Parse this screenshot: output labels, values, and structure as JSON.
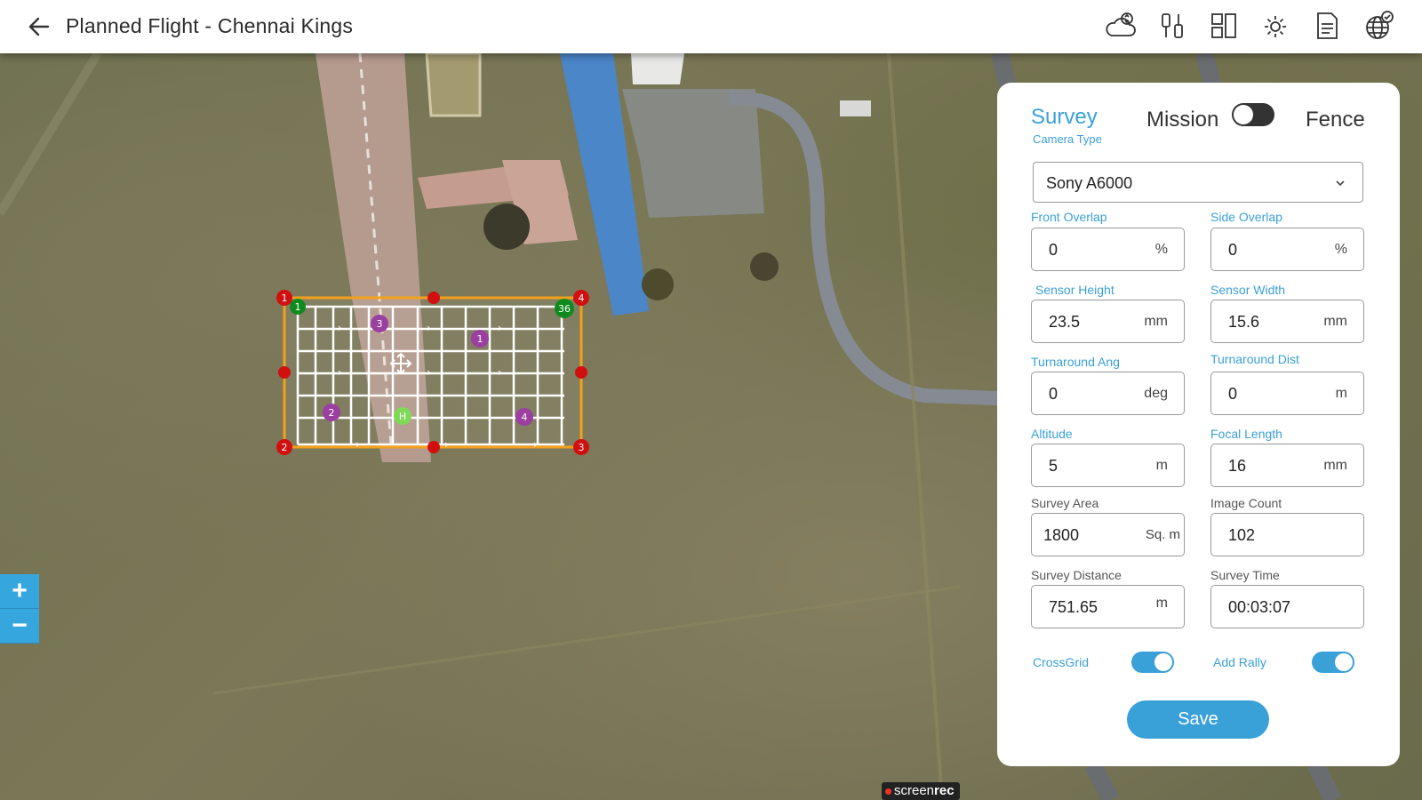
{
  "header": {
    "title": "Planned Flight - Chennai Kings",
    "tools": [
      "weather-sync-icon",
      "drone-sync-icon",
      "layout-icon",
      "settings-icon",
      "document-icon",
      "globe-check-icon"
    ]
  },
  "map": {
    "zoom_in_label": "+",
    "zoom_out_label": "−",
    "vertices": {
      "v1": "1",
      "v2": "2",
      "v3": "3",
      "v4": "4"
    },
    "waypoint_start": "1",
    "waypoint_end": "36",
    "rally_points": {
      "r1": "1",
      "r2": "2",
      "r3": "3",
      "r4": "4"
    },
    "home_label": "H"
  },
  "watermark": {
    "part1": "screen",
    "part2": "rec"
  },
  "panel": {
    "tabs": {
      "survey": "Survey",
      "mission": "Mission",
      "fence": "Fence"
    },
    "camera_type_label": "Camera Type",
    "camera_type_value": "Sony A6000",
    "fields": {
      "front_overlap": {
        "label": "Front Overlap",
        "value": "0",
        "unit": "%"
      },
      "side_overlap": {
        "label": "Side Overlap",
        "value": "0",
        "unit": "%"
      },
      "sensor_height": {
        "label": "Sensor Height",
        "value": "23.5",
        "unit": "mm"
      },
      "sensor_width": {
        "label": "Sensor Width",
        "value": "15.6",
        "unit": "mm"
      },
      "turnaround_ang": {
        "label": "Turnaround Ang",
        "value": "0",
        "unit": "deg"
      },
      "turnaround_dist": {
        "label": "Turnaround Dist",
        "value": "0",
        "unit": "m"
      },
      "altitude": {
        "label": "Altitude",
        "value": "5",
        "unit": "m"
      },
      "focal_length": {
        "label": "Focal Length",
        "value": "16",
        "unit": "mm"
      },
      "survey_area": {
        "label": "Survey Area",
        "value": "1800",
        "unit": "Sq. m"
      },
      "image_count": {
        "label": "Image Count",
        "value": "102"
      },
      "survey_distance": {
        "label": "Survey Distance",
        "value": "751.65",
        "unit": "m"
      },
      "survey_time": {
        "label": "Survey Time",
        "value": "00:03:07"
      }
    },
    "crossgrid_label": "CrossGrid",
    "crossgrid_on": true,
    "add_rally_label": "Add Rally",
    "add_rally_on": true,
    "save_label": "Save"
  },
  "colors": {
    "accent": "#3aa0d8",
    "vertex": "#d10f0f",
    "waypoint": "#0f8a1f",
    "rally": "#9b3fa0",
    "home": "#7ed957",
    "boundary": "#f5a01a"
  }
}
